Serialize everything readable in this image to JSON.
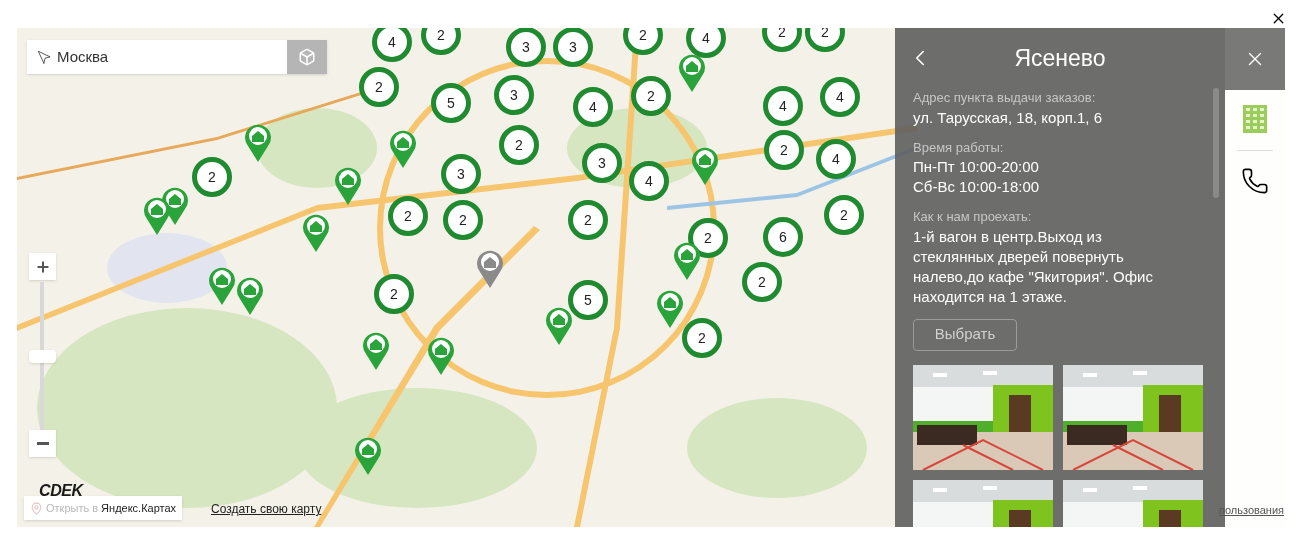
{
  "search": {
    "value": "Москва"
  },
  "zoom": {
    "level": 0.5
  },
  "clusters": [
    {
      "count": "4"
    },
    {
      "count": "2"
    },
    {
      "count": "3"
    },
    {
      "count": "3"
    },
    {
      "count": "2"
    },
    {
      "count": "4"
    },
    {
      "count": "2"
    },
    {
      "count": "2"
    },
    {
      "count": "2"
    },
    {
      "count": "5"
    },
    {
      "count": "3"
    },
    {
      "count": "4"
    },
    {
      "count": "2"
    },
    {
      "count": "4"
    },
    {
      "count": "4"
    },
    {
      "count": "2"
    },
    {
      "count": "3"
    },
    {
      "count": "4"
    },
    {
      "count": "2"
    },
    {
      "count": "4"
    },
    {
      "count": "2"
    },
    {
      "count": "3"
    },
    {
      "count": "2"
    },
    {
      "count": "2"
    },
    {
      "count": "2"
    },
    {
      "count": "2"
    },
    {
      "count": "6"
    },
    {
      "count": "2"
    },
    {
      "count": "2"
    },
    {
      "count": "2"
    },
    {
      "count": "5"
    },
    {
      "count": "2"
    }
  ],
  "pins": [
    {
      "selected": false
    },
    {
      "selected": false
    },
    {
      "selected": false
    },
    {
      "selected": false
    },
    {
      "selected": false
    },
    {
      "selected": false
    },
    {
      "selected": false
    },
    {
      "selected": false
    },
    {
      "selected": false
    },
    {
      "selected": false
    },
    {
      "selected": false
    },
    {
      "selected": false
    },
    {
      "selected": false
    },
    {
      "selected": false
    },
    {
      "selected": false
    },
    {
      "selected": false
    },
    {
      "selected": true
    }
  ],
  "panel": {
    "title": "Ясенево",
    "sections": [
      {
        "label": "Адрес пункта выдачи заказов:",
        "lines": [
          "ул. Тарусская, 18, корп.1, 6"
        ]
      },
      {
        "label": "Время работы:",
        "lines": [
          "Пн-Пт 10:00-20:00",
          "Сб-Вс 10:00-18:00"
        ]
      },
      {
        "label": "Как к нам проехать:",
        "lines": [
          "1-й вагон в центр.Выход из стеклянных дверей повернуть налево,до кафе \"Якитория\". Офис находится на 1 этаже."
        ]
      }
    ],
    "button": "Выбрать"
  },
  "logo": "CDEK",
  "open_link": {
    "prefix": "Открыть в",
    "name": "Яндекс.Картах"
  },
  "create_link": "Создать свою карту",
  "terms_link": "пользования"
}
